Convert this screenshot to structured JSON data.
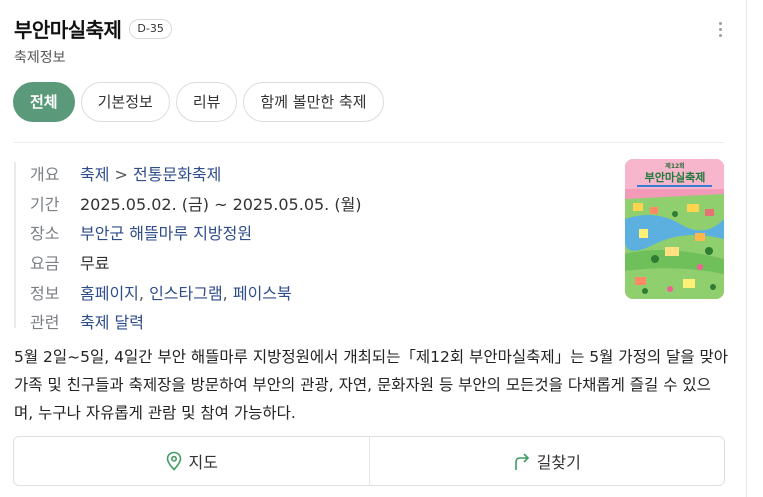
{
  "header": {
    "title": "부안마실축제",
    "dday": "D-35",
    "subtitle": "축제정보"
  },
  "tabs": [
    {
      "label": "전체",
      "active": true
    },
    {
      "label": "기본정보",
      "active": false
    },
    {
      "label": "리뷰",
      "active": false
    },
    {
      "label": "함께 볼만한 축제",
      "active": false
    }
  ],
  "info": {
    "overview": {
      "label": "개요",
      "category": "축제",
      "separator": ">",
      "subcategory": "전통문화축제"
    },
    "period": {
      "label": "기간",
      "value": "2025.05.02. (금) ~  2025.05.05. (월)"
    },
    "place": {
      "label": "장소",
      "value": "부안군 해뜰마루 지방정원"
    },
    "fee": {
      "label": "요금",
      "value": "무료"
    },
    "links": {
      "label": "정보",
      "items": [
        "홈페이지",
        "인스타그램",
        "페이스북"
      ]
    },
    "related": {
      "label": "관련",
      "value": "축제 달력"
    }
  },
  "poster": {
    "title": "부안마실축제",
    "top_text": "제12회 부안마실축제"
  },
  "description": "5월 2일~5일, 4일간 부안 해뜰마루 지방정원에서 개최되는「제12회 부안마실축제」는 5월 가정의 달을 맞아 가족 및 친구들과 축제장을 방문하여 부안의 관광, 자연, 문화자원 등 부안의 모든것을 다채롭게 즐길 수 있으며, 누구나 자유롭게 관람 및 참여 가능하다.",
  "actions": {
    "map": "지도",
    "directions": "길찾기"
  },
  "colors": {
    "accent": "#5a9a7a",
    "link": "#2f4d8a",
    "icon": "#3f9c63",
    "poster_bg": "#f29ab7"
  }
}
